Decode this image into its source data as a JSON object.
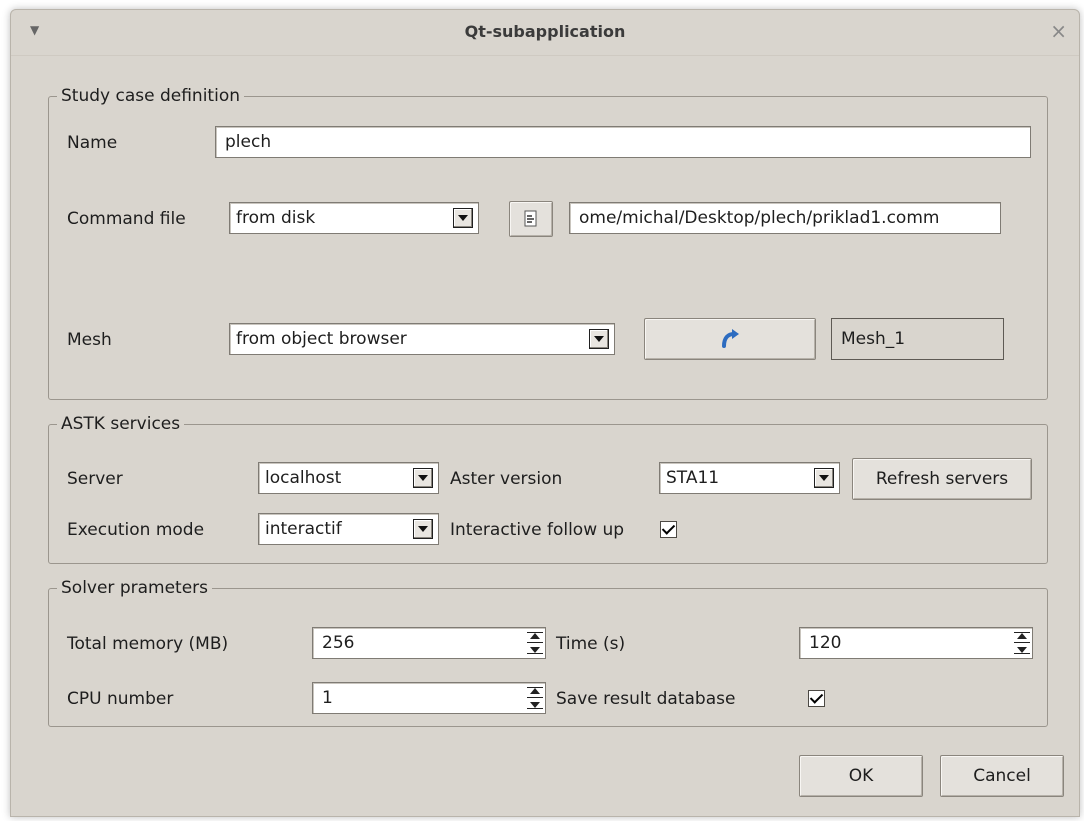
{
  "window": {
    "title": "Qt-subapplication"
  },
  "study": {
    "group_title": "Study case definition",
    "name_label": "Name",
    "name_value": "plech",
    "command_label": "Command file",
    "command_mode": "from disk",
    "command_path": "ome/michal/Desktop/plech/priklad1.comm",
    "mesh_label": "Mesh",
    "mesh_mode": "from object browser",
    "mesh_value": "Mesh_1"
  },
  "astk": {
    "group_title": "ASTK services",
    "server_label": "Server",
    "server_value": "localhost",
    "aster_label": "Aster version",
    "aster_value": "STA11",
    "refresh_label": "Refresh servers",
    "mode_label": "Execution mode",
    "mode_value": "interactif",
    "followup_label": "Interactive follow up",
    "followup_checked": true
  },
  "solver": {
    "group_title": "Solver prameters",
    "memory_label": "Total memory (MB)",
    "memory_value": "256",
    "time_label": "Time (s)",
    "time_value": "120",
    "cpu_label": "CPU number",
    "cpu_value": "1",
    "save_label": "Save result database",
    "save_checked": true
  },
  "buttons": {
    "ok": "OK",
    "cancel": "Cancel"
  },
  "colors": {
    "window_bg": "#d9d5ce",
    "arrow_icon": "#2d6cc0"
  }
}
